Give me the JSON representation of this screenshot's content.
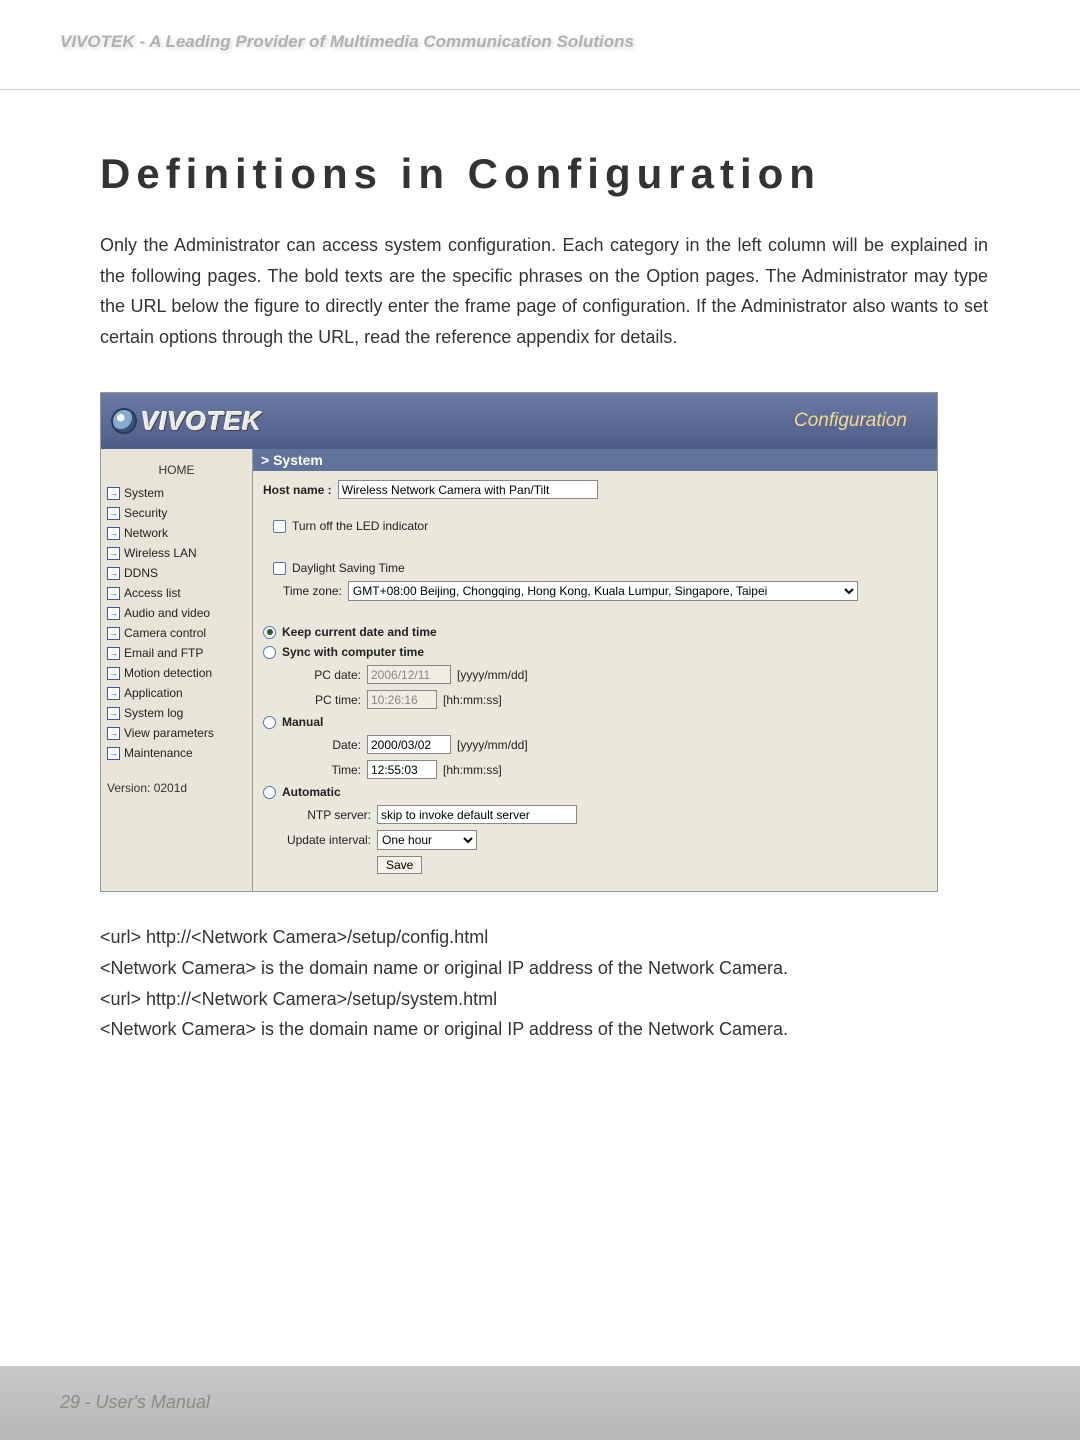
{
  "header": {
    "brandline": "VIVOTEK - A Leading Provider of Multimedia Communication Solutions"
  },
  "title": "Definitions in Configuration",
  "intro": "Only the Administrator can access system configuration. Each category in the left column will be explained in the following pages. The bold texts are the specific phrases on the Option pages. The Administrator may type the URL below the figure to directly enter the frame page of configuration. If the Administrator also wants to set certain options through the URL, read the reference appendix for details.",
  "logo_text": "VIVOTEK",
  "config_word": "Configuration",
  "section_title": "> System",
  "sidebar": {
    "home": "HOME",
    "items": [
      "System",
      "Security",
      "Network",
      "Wireless LAN",
      "DDNS",
      "Access list",
      "Audio and video",
      "Camera control",
      "Email and FTP",
      "Motion detection",
      "Application",
      "System log",
      "View parameters",
      "Maintenance"
    ],
    "version": "Version: 0201d"
  },
  "form": {
    "hostname_label": "Host name :",
    "hostname_value": "Wireless Network Camera with Pan/Tilt",
    "led_label": "Turn off the LED indicator",
    "dst_label": "Daylight Saving Time",
    "timezone_label": "Time zone:",
    "timezone_value": "GMT+08:00 Beijing, Chongqing, Hong Kong, Kuala Lumpur, Singapore, Taipei",
    "opt_keep": "Keep current date and time",
    "opt_sync": "Sync with computer time",
    "pc_date_label": "PC date:",
    "pc_date_value": "2006/12/11",
    "pc_date_hint": "[yyyy/mm/dd]",
    "pc_time_label": "PC time:",
    "pc_time_value": "10:26:16",
    "pc_time_hint": "[hh:mm:ss]",
    "opt_manual": "Manual",
    "m_date_label": "Date:",
    "m_date_value": "2000/03/02",
    "m_date_hint": "[yyyy/mm/dd]",
    "m_time_label": "Time:",
    "m_time_value": "12:55:03",
    "m_time_hint": "[hh:mm:ss]",
    "opt_auto": "Automatic",
    "ntp_label": "NTP server:",
    "ntp_value": "skip to invoke default server",
    "update_label": "Update interval:",
    "update_value": "One hour",
    "save": "Save"
  },
  "urls": {
    "l1": "<url> http://<Network Camera>/setup/config.html",
    "l2": "<Network Camera> is the domain name or original IP address of the Network Camera.",
    "l3": "<url> http://<Network Camera>/setup/system.html",
    "l4": "<Network Camera> is the domain name or original IP address of the Network Camera."
  },
  "footer": {
    "page": "29",
    "label": "User's Manual"
  }
}
